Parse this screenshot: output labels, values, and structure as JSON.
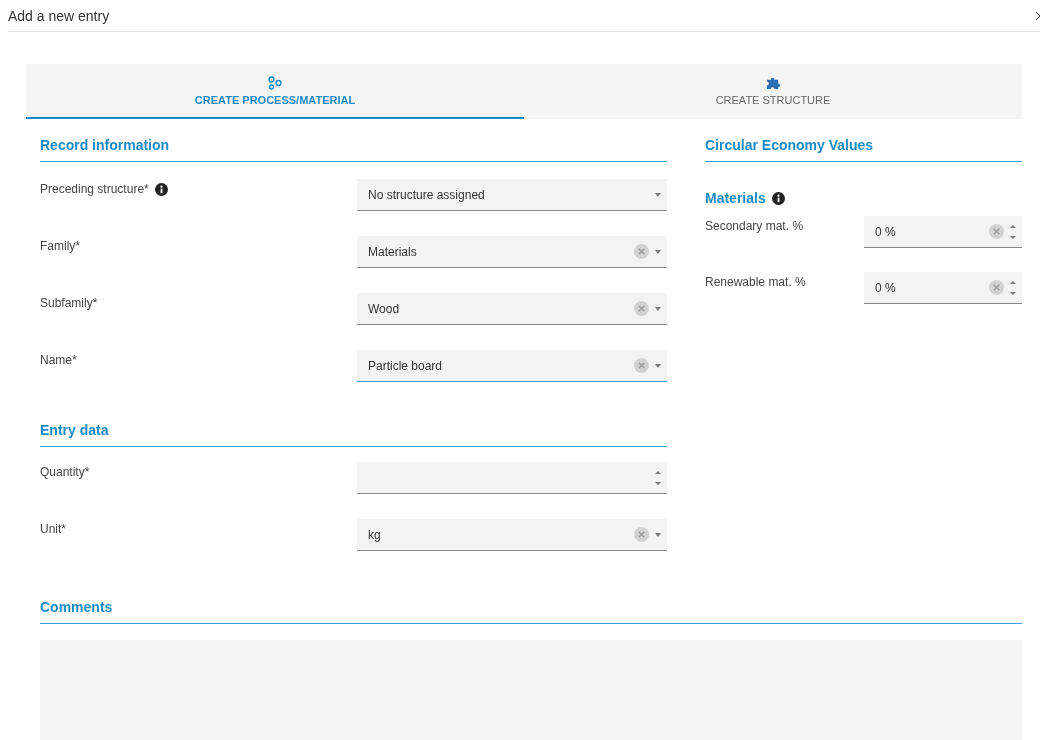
{
  "dialog": {
    "title": "Add a new entry"
  },
  "tabs": [
    {
      "label": "CREATE PROCESS/MATERIAL",
      "kind": "process",
      "selected": true
    },
    {
      "label": "CREATE STRUCTURE",
      "kind": "puzzle",
      "selected": false
    }
  ],
  "record_information": {
    "title": "Record information",
    "fields": [
      {
        "label": "Preceding structure*",
        "info": true,
        "kind": "select",
        "value": "No structure assigned",
        "clearable": false,
        "focused": false
      },
      {
        "label": "Family*",
        "info": false,
        "kind": "select",
        "value": "Materials",
        "clearable": true,
        "focused": false
      },
      {
        "label": "Subfamily*",
        "info": false,
        "kind": "select",
        "value": "Wood",
        "clearable": true,
        "focused": false
      },
      {
        "label": "Name*",
        "info": false,
        "kind": "select",
        "value": "Particle board",
        "clearable": true,
        "focused": true
      }
    ]
  },
  "entry_data": {
    "title": "Entry data",
    "fields": [
      {
        "label": "Quantity*",
        "info": false,
        "kind": "number",
        "clearable": false,
        "focused": false
      },
      {
        "label": "Unit*",
        "info": false,
        "kind": "select",
        "value": "kg",
        "clearable": true,
        "focused": false
      }
    ]
  },
  "circular_economy": {
    "title": "Circular Economy Values",
    "subtitle": "Materials",
    "subtitle_info": true,
    "fields": [
      {
        "label": "Secondary mat. %",
        "kind": "number",
        "value": "0 %",
        "clearable": true
      },
      {
        "label": "Renewable mat. %",
        "kind": "number",
        "value": "0 %",
        "clearable": true
      }
    ]
  },
  "comments": {
    "title": "Comments"
  }
}
